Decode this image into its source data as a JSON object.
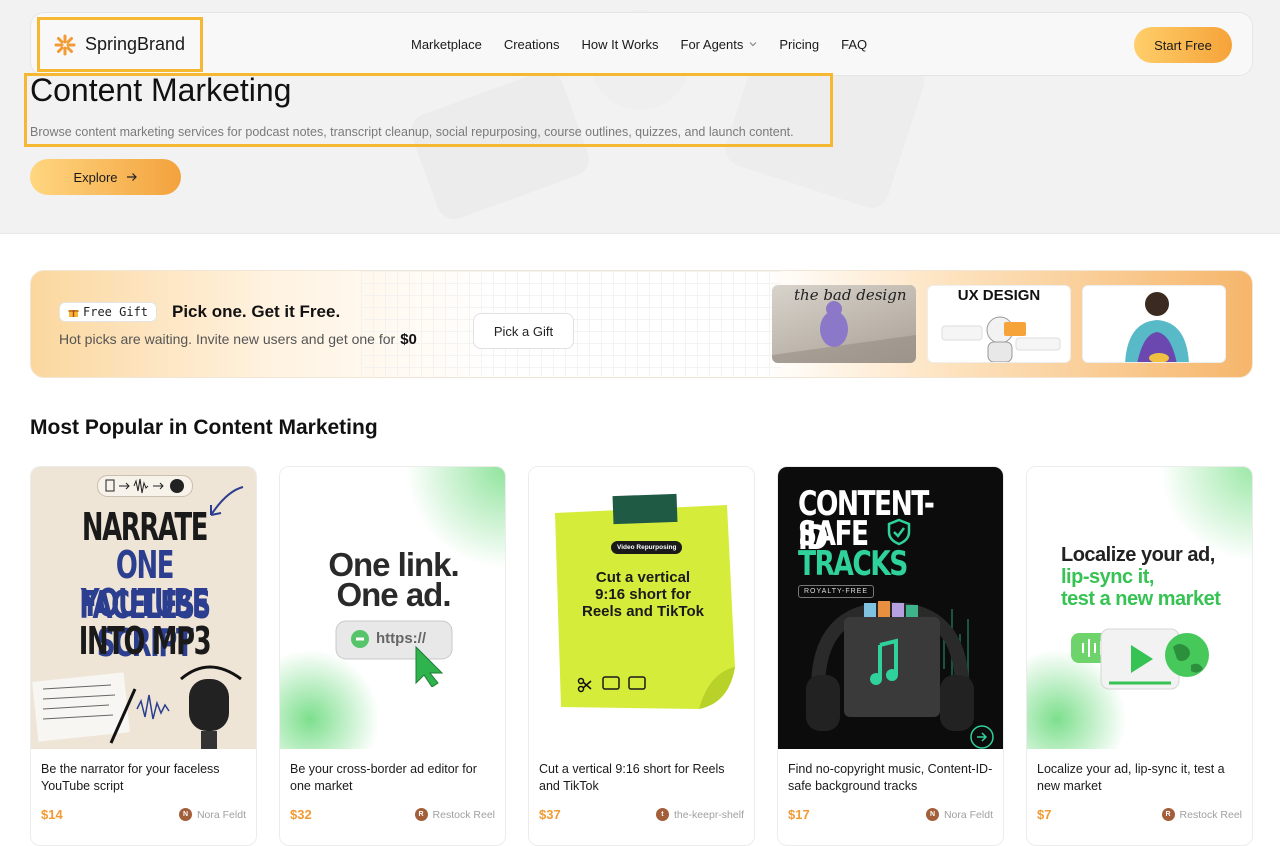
{
  "brand": {
    "name": "SpringBrand",
    "accent": "#f6b733",
    "orange": "#f29a33"
  },
  "nav": {
    "links": [
      "Marketplace",
      "Creations",
      "How It Works",
      "For Agents",
      "Pricing",
      "FAQ"
    ],
    "start_label": "Start Free"
  },
  "hero": {
    "title": "Content Marketing",
    "subtitle": "Browse content marketing services for podcast notes, transcript cleanup, social repurposing, course outlines, quizzes, and launch content.",
    "explore_label": "Explore"
  },
  "gift": {
    "badge_icon": "gift-icon",
    "badge": "Free Gift",
    "title": "Pick one. Get it Free.",
    "subtitle": "Hot picks are waiting. Invite new users and get one for",
    "price": "$0",
    "button": "Pick a Gift",
    "thumbs": [
      "the bad design",
      "UX DESIGN",
      ""
    ]
  },
  "section_title": "Most Popular in Content Marketing",
  "cards": [
    {
      "image_text": [
        "NARRATE",
        "ONE FACELESS",
        "YOUTUBE SCRIPT",
        "INTO MP3"
      ],
      "description": "Be the narrator for your faceless YouTube script",
      "price": "$14",
      "seller_initial": "N",
      "seller": "Nora Feldt"
    },
    {
      "image_text": [
        "One link.",
        "One ad.",
        "https://"
      ],
      "description": "Be your cross-border ad editor for one market",
      "price": "$32",
      "seller_initial": "R",
      "seller": "Restock Reel"
    },
    {
      "image_text": [
        "Video Repurposing",
        "Cut a vertical",
        "9:16 short for",
        "Reels and TikTok"
      ],
      "description": "Cut a vertical 9:16 short for Reels and TikTok",
      "price": "$37",
      "seller_initial": "t",
      "seller": "the-keepr-shelf"
    },
    {
      "image_text": [
        "CONTENT-ID",
        "SAFE",
        "TRACKS",
        "ROYALTY-FREE"
      ],
      "description": "Find no-copyright music, Content-ID-safe background tracks",
      "price": "$17",
      "seller_initial": "N",
      "seller": "Nora Feldt"
    },
    {
      "image_text": [
        "Localize your ad,",
        "lip-sync it,",
        "test a new market"
      ],
      "description": "Localize your ad, lip-sync it, test a new market",
      "price": "$7",
      "seller_initial": "R",
      "seller": "Restock Reel"
    }
  ]
}
